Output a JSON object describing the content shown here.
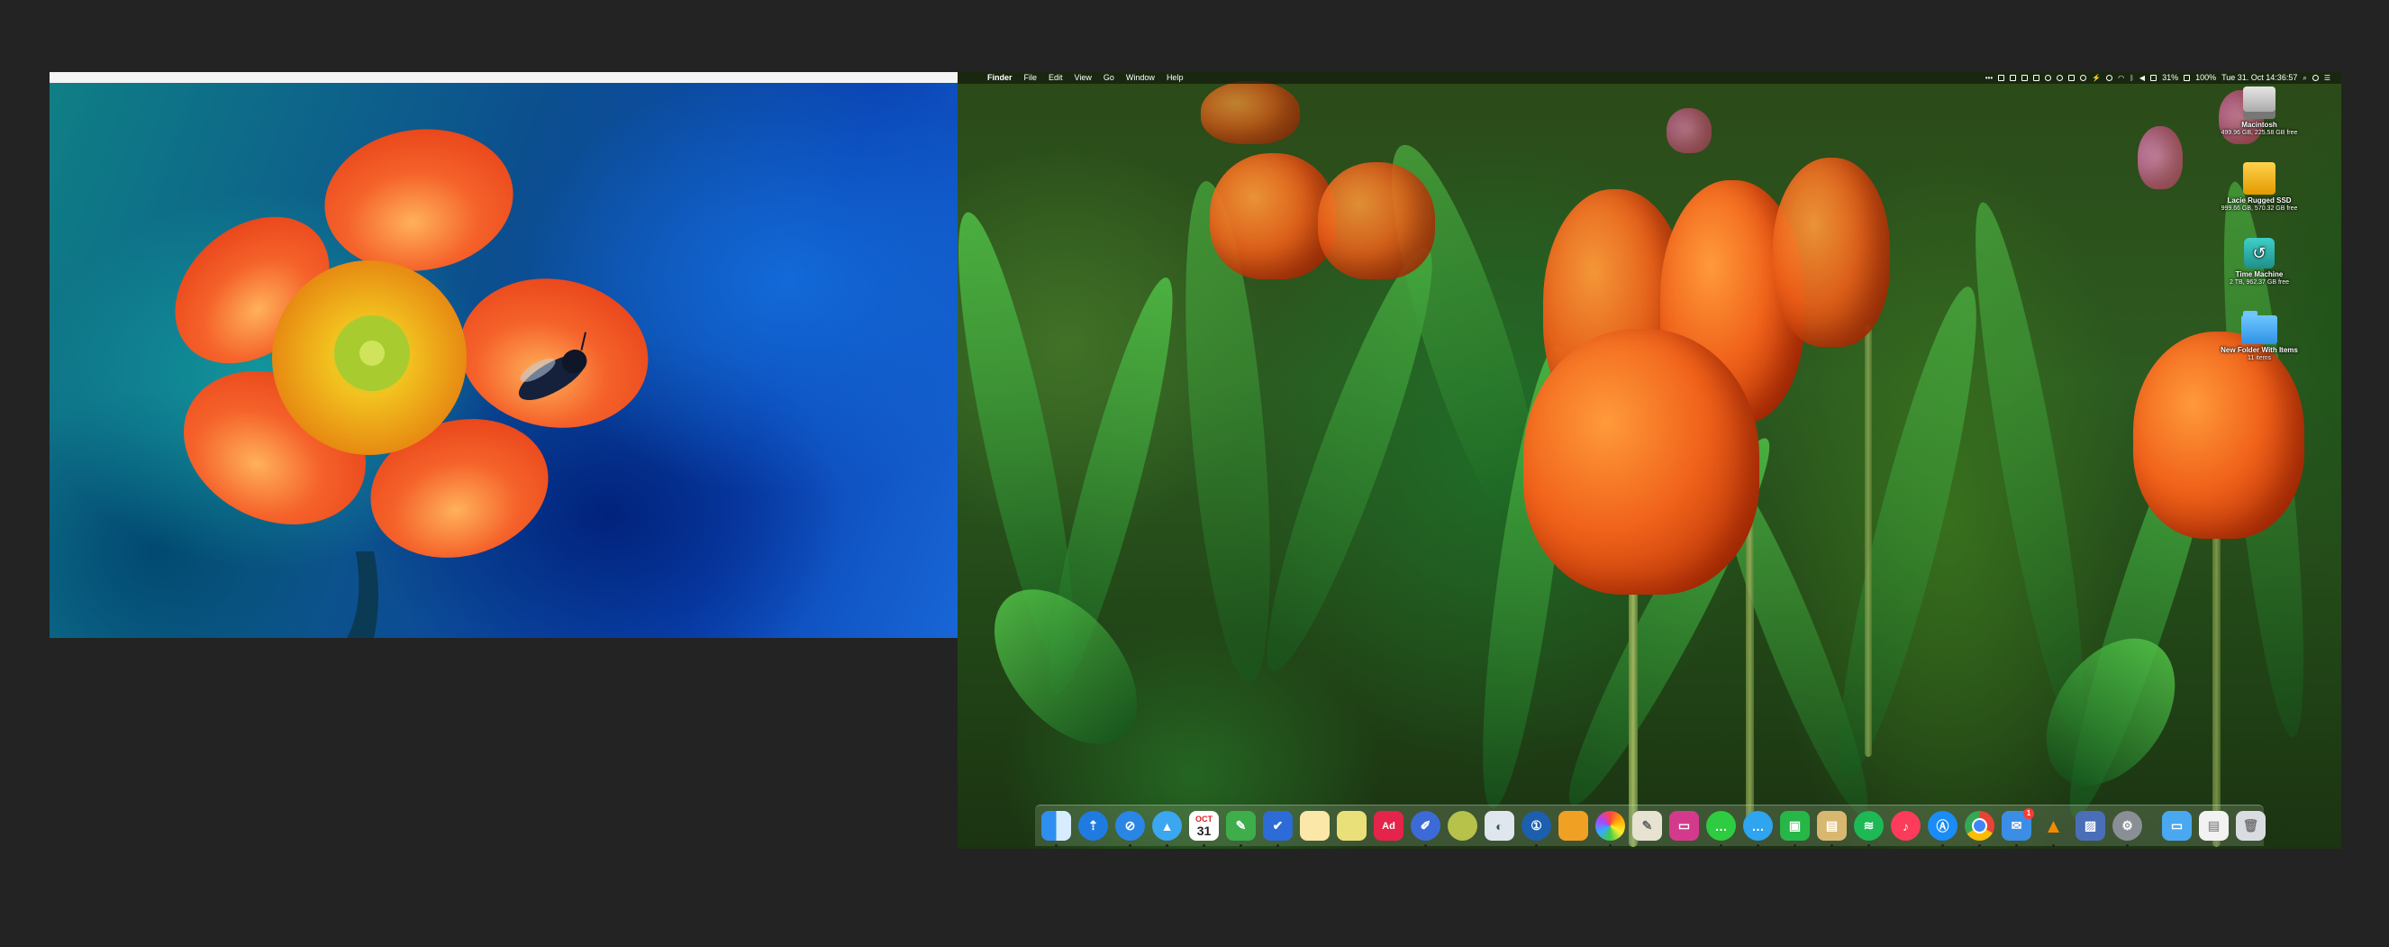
{
  "menubar": {
    "app_name": "Finder",
    "menus": [
      "File",
      "Edit",
      "View",
      "Go",
      "Window",
      "Help"
    ],
    "battery_a": "31%",
    "battery_b": "100%",
    "clock": "Tue 31. Oct  14:36:57"
  },
  "desktop_items": [
    {
      "name": "Macintosh",
      "detail": "499.96 GB, 225.58 GB free",
      "icon": "hard-drive-icon"
    },
    {
      "name": "Lacie Rugged SSD",
      "detail": "999.66 GB, 570.32 GB free",
      "icon": "external-drive-icon"
    },
    {
      "name": "Time Machine",
      "detail": "2 TB, 962.37 GB free",
      "icon": "time-machine-icon"
    },
    {
      "name": "New Folder With Items",
      "detail": "11 items",
      "icon": "folder-icon"
    }
  ],
  "dock": {
    "calendar_day": "31",
    "calendar_month": "OCT",
    "acrobat_label": "Ad",
    "mail_badge": "1"
  },
  "colors": {
    "menubar_bg": "#1e2a14",
    "dock_bg": "#9aaa8c",
    "tulip": "#f0621a",
    "flower_petal": "#f25a1e"
  }
}
